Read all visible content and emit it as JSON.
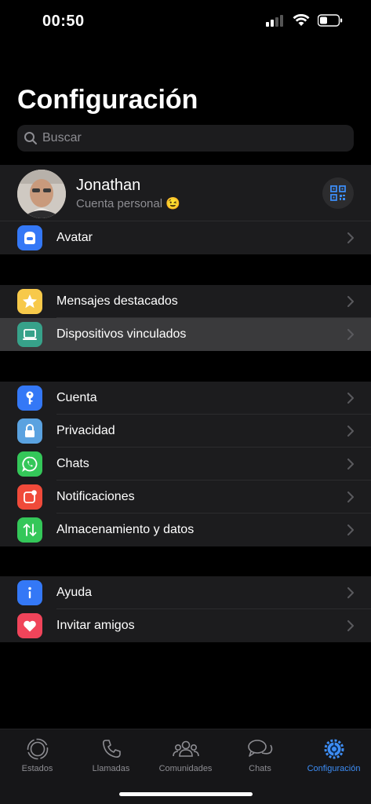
{
  "status_bar": {
    "time": "00:50"
  },
  "header": {
    "title": "Configuración"
  },
  "search": {
    "placeholder": "Buscar"
  },
  "profile": {
    "name": "Jonathan",
    "subtitle": "Cuenta personal",
    "emoji": "😉"
  },
  "groups": {
    "avatar": {
      "label": "Avatar"
    },
    "starred": {
      "label": "Mensajes destacados"
    },
    "devices": {
      "label": "Dispositivos vinculados"
    },
    "account": {
      "label": "Cuenta"
    },
    "privacy": {
      "label": "Privacidad"
    },
    "chats": {
      "label": "Chats"
    },
    "notifications": {
      "label": "Notificaciones"
    },
    "storage": {
      "label": "Almacenamiento y datos"
    },
    "help": {
      "label": "Ayuda"
    },
    "invite": {
      "label": "Invitar amigos"
    }
  },
  "tabbar": {
    "estados": "Estados",
    "llamadas": "Llamadas",
    "comunidades": "Comunidades",
    "chats": "Chats",
    "configuracion": "Configuración"
  },
  "colors": {
    "accent": "#3d8df5",
    "avatar_icon": "#3478f6",
    "star_icon": "#f7c94a",
    "devices_icon": "#37a28a",
    "account_icon": "#3478f6",
    "privacy_icon": "#5aa2e0",
    "chats_icon": "#34c759",
    "notifications_icon": "#f04a3a",
    "storage_icon": "#34c759",
    "help_icon": "#3478f6",
    "invite_icon": "#f0445a"
  }
}
